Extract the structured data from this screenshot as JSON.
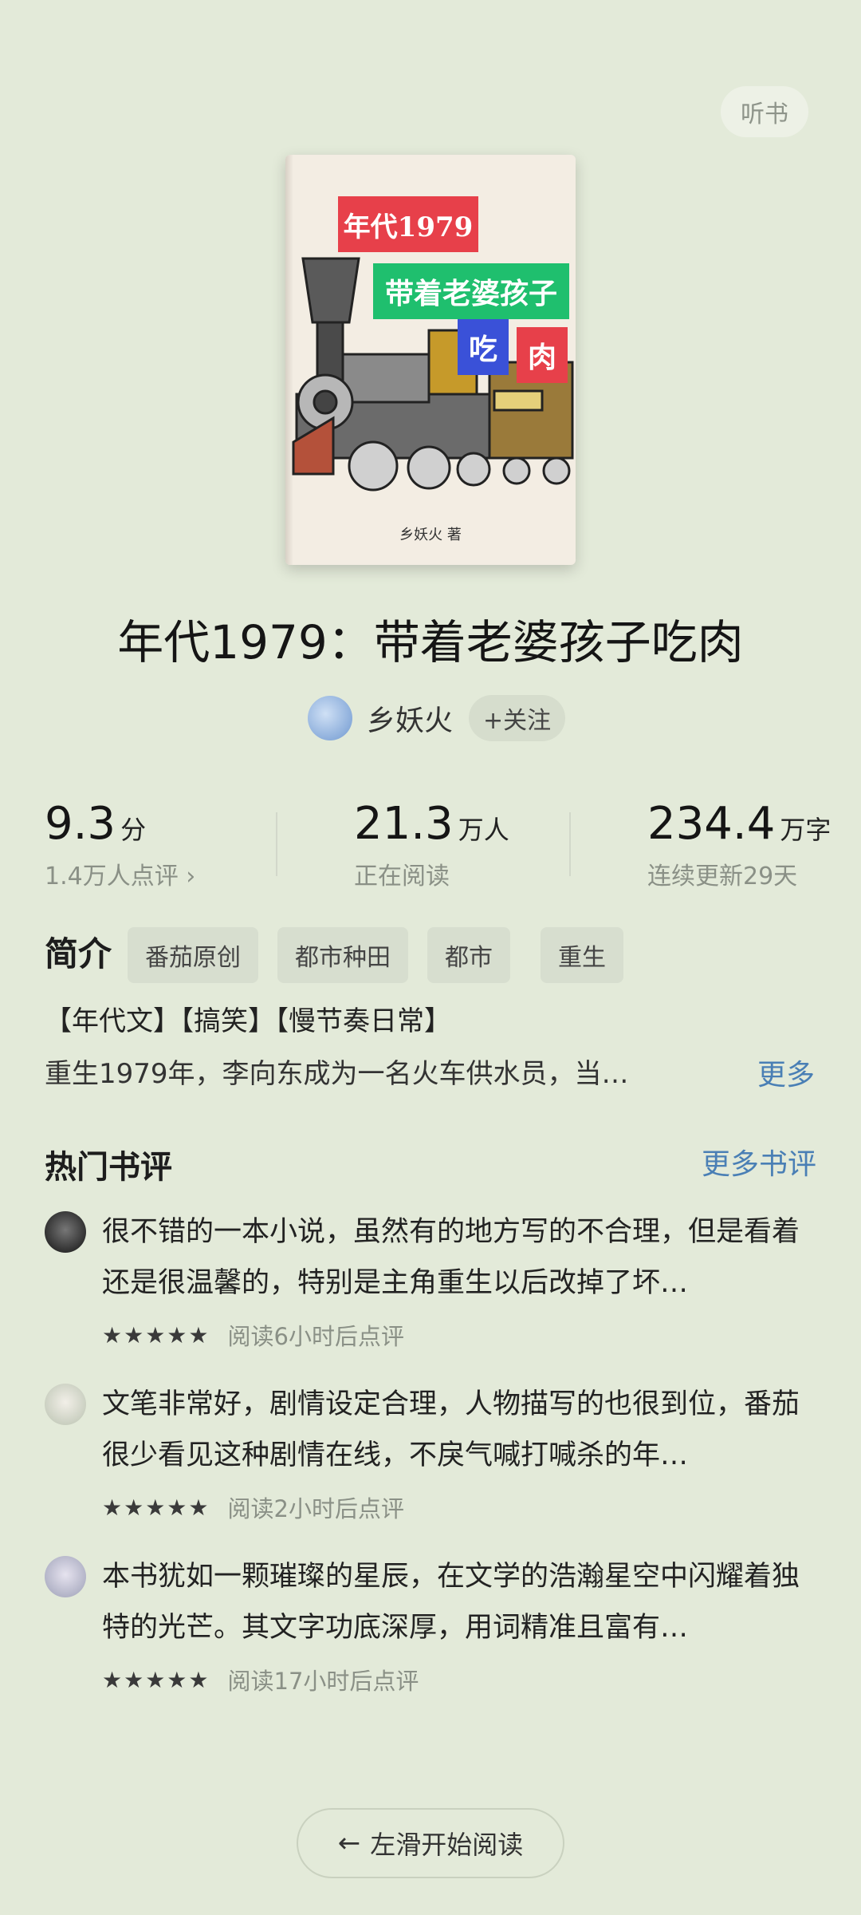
{
  "listen_label": "听书",
  "cover": {
    "tags": [
      "年代1979",
      "带着老婆孩子",
      "吃",
      "肉"
    ],
    "author_line": "乡妖火 著"
  },
  "book": {
    "title": "年代1979：带着老婆孩子吃肉",
    "author": "乡妖火",
    "follow_label": "+关注"
  },
  "stats": [
    {
      "value": "9.3",
      "unit": "分",
      "sub": "1.4万人点评 ›"
    },
    {
      "value": "21.3",
      "unit": "万人",
      "sub": "正在阅读"
    },
    {
      "value": "234.4",
      "unit": "万字",
      "sub": "连续更新29天"
    }
  ],
  "intro": {
    "label": "简介",
    "tags": [
      "番茄原创",
      "都市种田",
      "都市",
      "重生"
    ],
    "keywords": "【年代文】【搞笑】【慢节奏日常】",
    "summary": "重生1979年，李向东成为一名火车供水员，当…",
    "more_label": "更多"
  },
  "reviews_section": {
    "title": "热门书评",
    "more_label": "更多书评",
    "items": [
      {
        "text": "很不错的一本小说，虽然有的地方写的不合理，但是看着还是很温馨的，特别是主角重生以后改掉了坏…",
        "stars": "★★★★★",
        "time": "阅读6小时后点评"
      },
      {
        "text": "文笔非常好，剧情设定合理，人物描写的也很到位，番茄很少看见这种剧情在线，不戾气喊打喊杀的年…",
        "stars": "★★★★★",
        "time": "阅读2小时后点评"
      },
      {
        "text": "本书犹如一颗璀璨的星辰，在文学的浩瀚星空中闪耀着独特的光芒。其文字功底深厚，用词精准且富有…",
        "stars": "★★★★★",
        "time": "阅读17小时后点评"
      }
    ]
  },
  "start_button": {
    "arrow": "←",
    "label": "左滑开始阅读"
  }
}
